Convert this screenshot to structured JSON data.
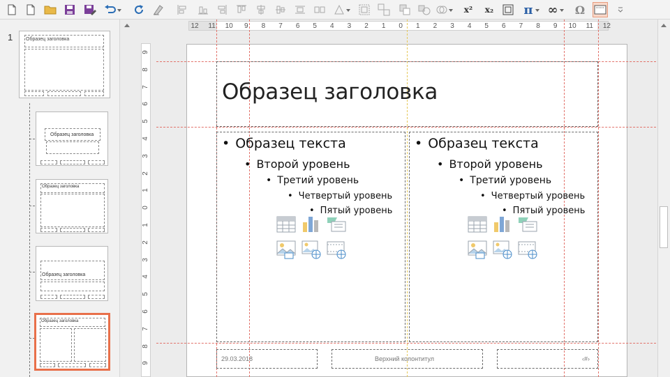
{
  "toolbar": {
    "superscript_label": "x²",
    "subscript_label": "x₂",
    "pi_label": "π",
    "infinity_label": "∞",
    "omega_label": "Ω",
    "icons": [
      "new-document-icon",
      "open-folder-icon",
      "save-icon",
      "save-as-icon",
      "undo-icon",
      "redo-icon",
      "clear-formatting-icon",
      "align-left-objects-icon",
      "align-bottom-objects-icon",
      "align-right-objects-icon",
      "align-center-objects-icon",
      "align-middle-objects-icon",
      "distribute-icon",
      "shapes-icon",
      "group-icon",
      "ungroup-icon",
      "bring-forward-icon",
      "arrange-icon",
      "merge-shapes-icon",
      "superscript-icon",
      "subscript-icon",
      "crop-icon",
      "equation-icon",
      "infinity-icon",
      "symbol-icon",
      "slide-master-icon",
      "more-icon"
    ]
  },
  "sidebar": {
    "slide_number": "1",
    "thumbnails": [
      {
        "title": "Образец заголовка"
      },
      {
        "title": "Образец заголовка"
      },
      {
        "title": "Образец заголовка"
      },
      {
        "title": "Образец заголовка"
      },
      {
        "title": "Образец заголовка"
      }
    ]
  },
  "ruler": {
    "h_labels": [
      "12",
      "11",
      "10",
      "9",
      "8",
      "7",
      "6",
      "5",
      "4",
      "3",
      "2",
      "1",
      "0",
      "1",
      "2",
      "3",
      "4",
      "5",
      "6",
      "7",
      "8",
      "9",
      "10",
      "11",
      "12"
    ],
    "v_labels": [
      "9",
      "8",
      "7",
      "6",
      "5",
      "4",
      "3",
      "2",
      "1",
      "0",
      "1",
      "2",
      "3",
      "4",
      "5",
      "6",
      "7",
      "8",
      "9"
    ]
  },
  "slide": {
    "title": "Образец заголовка",
    "left_column": {
      "level1": "Образец текста",
      "level2": "Второй уровень",
      "level3": "Третий уровень",
      "level4": "Четвертый уровень",
      "level5": "Пятый уровень"
    },
    "right_column": {
      "level1": "Образец текста",
      "level2": "Второй уровень",
      "level3": "Третий уровень",
      "level4": "Четвертый уровень",
      "level5": "Пятый уровень"
    },
    "bullet": "•",
    "footer": {
      "date": "29.03.2018",
      "header_footer": "Верхний колонтитул",
      "page_number": "‹#›"
    }
  },
  "colors": {
    "accent_selected": "#e8704a",
    "guide_red": "#e2726a",
    "guide_yellow": "#e6c85a"
  }
}
